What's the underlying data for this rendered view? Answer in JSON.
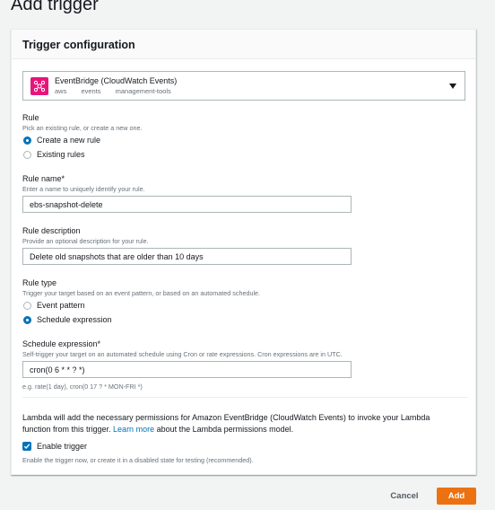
{
  "page": {
    "title": "Add trigger"
  },
  "panel": {
    "title": "Trigger configuration"
  },
  "service": {
    "name": "EventBridge (CloudWatch Events)",
    "tags": [
      "aws",
      "events",
      "management-tools"
    ],
    "icon": "eventbridge-icon",
    "icon_color": "#e7157b"
  },
  "rule": {
    "label": "Rule",
    "description": "Pick an existing rule, or create a new one.",
    "options": [
      {
        "label": "Create a new rule",
        "selected": true
      },
      {
        "label": "Existing rules",
        "selected": false
      }
    ]
  },
  "rule_name": {
    "label": "Rule name*",
    "description": "Enter a name to uniquely identify your rule.",
    "value": "ebs-snapshot-delete"
  },
  "rule_description": {
    "label": "Rule description",
    "description": "Provide an optional description for your rule.",
    "value": "Delete old snapshots that are older than 10 days"
  },
  "rule_type": {
    "label": "Rule type",
    "description": "Trigger your target based on an event pattern, or based on an automated schedule.",
    "options": [
      {
        "label": "Event pattern",
        "selected": false
      },
      {
        "label": "Schedule expression",
        "selected": true
      }
    ]
  },
  "schedule": {
    "label": "Schedule expression*",
    "description": "Self-trigger your target on an automated schedule using Cron or rate expressions. Cron expressions are in UTC.",
    "value": "cron(0 6 * * ? *)",
    "hint": "e.g. rate(1 day), cron(0 17 ? * MON-FRI *)"
  },
  "permissions": {
    "text_before": "Lambda will add the necessary permissions for Amazon EventBridge (CloudWatch Events) to invoke your Lambda function from this trigger. ",
    "link": "Learn more",
    "text_after": " about the Lambda permissions model."
  },
  "enable_trigger": {
    "label": "Enable trigger",
    "checked": true,
    "description": "Enable the trigger now, or create it in a disabled state for testing (recommended)."
  },
  "actions": {
    "cancel": "Cancel",
    "add": "Add"
  },
  "colors": {
    "accent": "#0073bb",
    "primary_button": "#ec7211"
  }
}
